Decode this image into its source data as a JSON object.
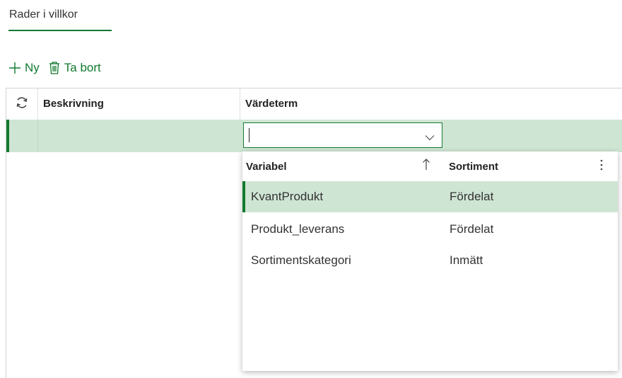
{
  "tab": {
    "label": "Rader i villkor"
  },
  "actions": {
    "new_label": "Ny",
    "delete_label": "Ta bort"
  },
  "grid": {
    "columns": {
      "description": "Beskrivning",
      "value_term": "Värdeterm"
    },
    "rows": [
      {
        "description": "",
        "value_term": ""
      }
    ]
  },
  "combobox": {
    "value": "",
    "placeholder": ""
  },
  "dropdown": {
    "columns": {
      "variable": "Variabel",
      "assortment": "Sortiment"
    },
    "sort": "ascending",
    "rows": [
      {
        "variable": "KvantProdukt",
        "assortment": "Fördelat",
        "selected": true
      },
      {
        "variable": "Produkt_leverans",
        "assortment": "Fördelat",
        "selected": false
      },
      {
        "variable": "Sortimentskategori",
        "assortment": "Inmätt",
        "selected": false
      }
    ]
  },
  "colors": {
    "accent": "#127a30",
    "selection": "#cfe5d4",
    "border": "#d2d2d2"
  }
}
